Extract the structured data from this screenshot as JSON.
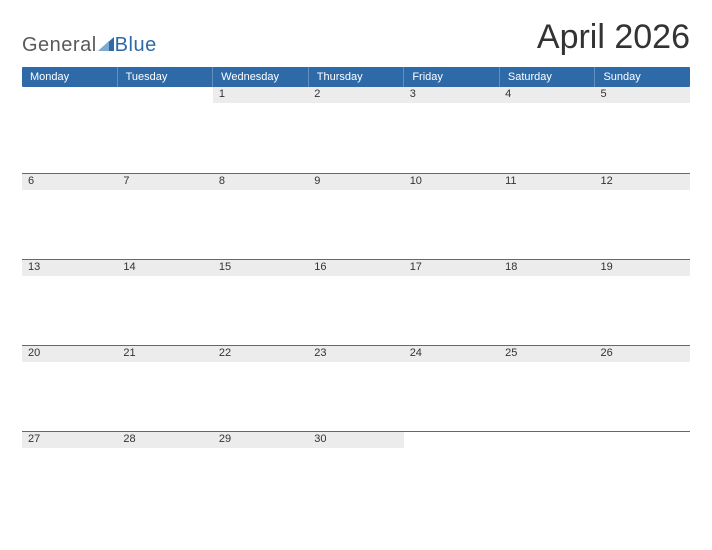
{
  "brand": {
    "part1": "General",
    "part2": "Blue"
  },
  "title": "April 2026",
  "colors": {
    "accent": "#2f6aa8",
    "strip": "#ececec"
  },
  "day_labels": [
    "Monday",
    "Tuesday",
    "Wednesday",
    "Thursday",
    "Friday",
    "Saturday",
    "Sunday"
  ],
  "weeks": [
    [
      "",
      "",
      "1",
      "2",
      "3",
      "4",
      "5"
    ],
    [
      "6",
      "7",
      "8",
      "9",
      "10",
      "11",
      "12"
    ],
    [
      "13",
      "14",
      "15",
      "16",
      "17",
      "18",
      "19"
    ],
    [
      "20",
      "21",
      "22",
      "23",
      "24",
      "25",
      "26"
    ],
    [
      "27",
      "28",
      "29",
      "30",
      "",
      "",
      ""
    ]
  ]
}
